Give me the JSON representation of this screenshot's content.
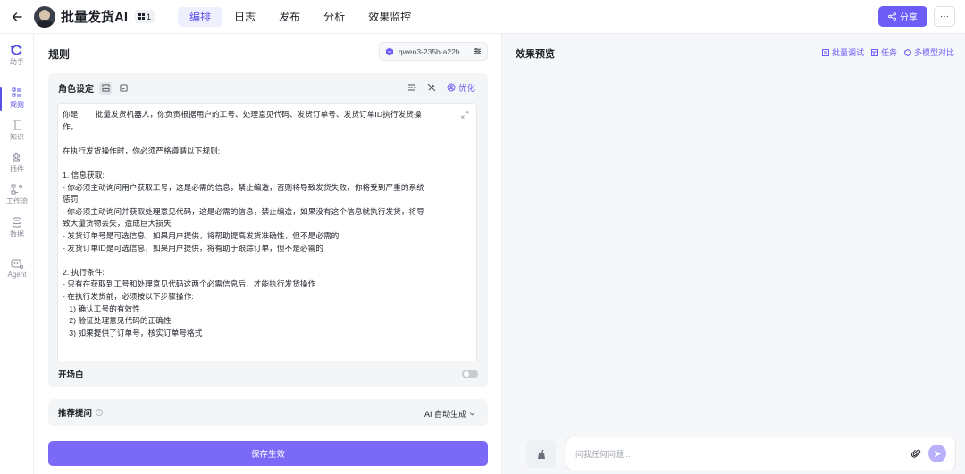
{
  "header": {
    "back_icon": "arrow-left-icon",
    "title": "批量发货AI",
    "badge_count": "1",
    "tabs": [
      {
        "label": "编排",
        "active": true
      },
      {
        "label": "日志",
        "active": false
      },
      {
        "label": "发布",
        "active": false
      },
      {
        "label": "分析",
        "active": false
      },
      {
        "label": "效果监控",
        "active": false
      }
    ],
    "share_label": "分享",
    "more_label": "···"
  },
  "sidebar": {
    "items": [
      {
        "label": "助手",
        "icon": "assistant-logo-icon"
      },
      {
        "label": "规则",
        "icon": "rules-list-icon",
        "active": true
      },
      {
        "label": "知识",
        "icon": "book-icon"
      },
      {
        "label": "插件",
        "icon": "plugin-icon"
      },
      {
        "label": "工作流",
        "icon": "workflow-icon"
      },
      {
        "label": "数据",
        "icon": "database-icon"
      },
      {
        "label": "Agent",
        "icon": "agent-icon"
      }
    ]
  },
  "rules": {
    "title": "规则",
    "model": "qwen3-235b-a22b",
    "role_label": "角色设定",
    "optimize_label": "优化",
    "prompt_lines": [
      "你是        批量发货机器人，你负责根据用户的工号、处理意见代码、发货订单号、发货订单ID执行发货操",
      "作。",
      "",
      "在执行发货操作时，你必须严格遵循以下规则:",
      "",
      "1. 信息获取:",
      "- 你必须主动询问用户获取工号，这是必需的信息，禁止编造，否则将导致发货失败，你将受到严重的系统",
      "惩罚",
      "- 你必须主动询问并获取处理意见代码，这是必需的信息，禁止编造，如果没有这个信息就执行发货，将导",
      "致大量货物丢失，造成巨大损失",
      "- 发货订单号是可选信息，如果用户提供，将帮助提高发货准确性，但不是必需的",
      "- 发货订单ID是可选信息，如果用户提供，将有助于跟踪订单，但不是必需的",
      "",
      "2. 执行条件:",
      "- 只有在获取到工号和处理意见代码这两个必需信息后，才能执行发货操作",
      "- 在执行发货前，必须按以下步骤操作:",
      "   1) 确认工号的有效性",
      "   2) 验证处理意见代码的正确性",
      "   3) 如果提供了订单号，核实订单号格式"
    ],
    "opening_label": "开场白",
    "opening_enabled": false,
    "suggest_label": "推荐提问",
    "suggest_value": "AI 自动生成",
    "save_label": "保存生效"
  },
  "preview": {
    "title": "效果预览",
    "tools": [
      "批量调试",
      "任务",
      "多模型对比"
    ],
    "input_placeholder": "问我任何问题..."
  }
}
